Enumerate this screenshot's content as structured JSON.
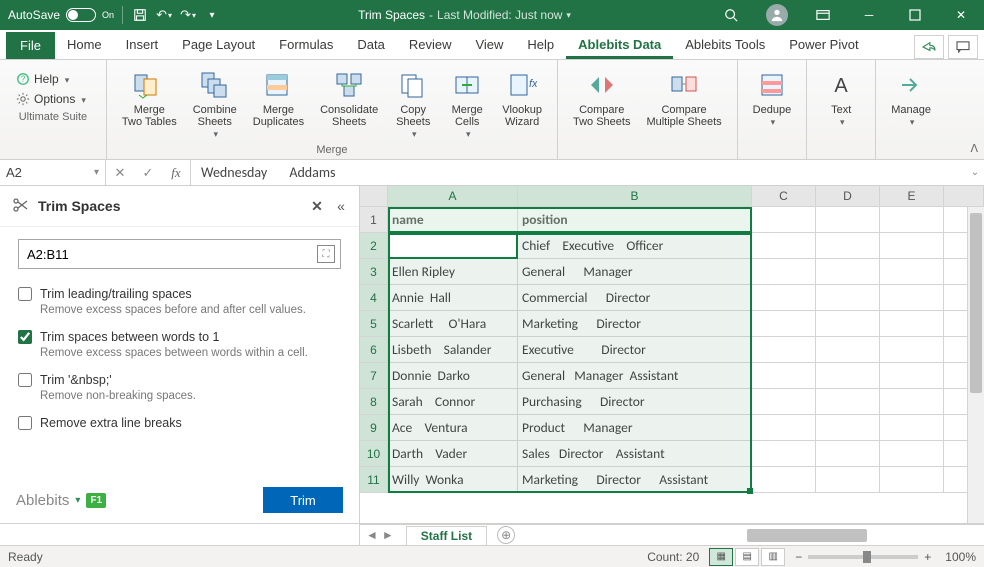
{
  "titlebar": {
    "autosave_label": "AutoSave",
    "autosave_state": "On",
    "filename": "Trim Spaces",
    "sep": "-",
    "modified": "Last Modified: Just now"
  },
  "tabs": {
    "file": "File",
    "items": [
      "Home",
      "Insert",
      "Page Layout",
      "Formulas",
      "Data",
      "Review",
      "View",
      "Help",
      "Ablebits Data",
      "Ablebits Tools",
      "Power Pivot"
    ],
    "active": "Ablebits Data"
  },
  "ribbon": {
    "help": "Help",
    "options": "Options",
    "group0": "Ultimate Suite",
    "merge": {
      "two_tables": "Merge\nTwo Tables",
      "combine_sheets": "Combine\nSheets",
      "merge_dupes": "Merge\nDuplicates",
      "consolidate": "Consolidate\nSheets",
      "copy_sheets": "Copy\nSheets",
      "merge_cells": "Merge\nCells",
      "vlookup": "Vlookup\nWizard",
      "label": "Merge"
    },
    "compare": {
      "two": "Compare\nTwo Sheets",
      "multi": "Compare\nMultiple Sheets"
    },
    "dedupe": "Dedupe",
    "text": "Text",
    "manage": "Manage"
  },
  "formula_bar": {
    "name_box": "A2",
    "value": "Wednesday       Addams"
  },
  "pane": {
    "title": "Trim Spaces",
    "range": "A2:B11",
    "opt1": {
      "label": "Trim leading/trailing spaces",
      "desc": "Remove excess spaces before and after cell values.",
      "checked": false
    },
    "opt2": {
      "label": "Trim spaces between words to 1",
      "desc": "Remove excess spaces between words within a cell.",
      "checked": true
    },
    "opt3": {
      "label": "Trim '&nbsp;'",
      "desc": "Remove non-breaking spaces.",
      "checked": false
    },
    "opt4": {
      "label": "Remove extra line breaks",
      "checked": false
    },
    "brand": "Ablebits",
    "f1": "F1",
    "button": "Trim"
  },
  "grid": {
    "columns": [
      "A",
      "B",
      "C",
      "D",
      "E"
    ],
    "headers": {
      "A": "name",
      "B": "position"
    },
    "rows": [
      {
        "n": 1,
        "A": "name",
        "B": "position"
      },
      {
        "n": 2,
        "A": "Wednesday       Addams",
        "B": "Chief    Executive    Officer"
      },
      {
        "n": 3,
        "A": "Ellen Ripley",
        "B": "General      Manager"
      },
      {
        "n": 4,
        "A": "Annie  Hall",
        "B": "Commercial      Director"
      },
      {
        "n": 5,
        "A": "Scarlett     O'Hara",
        "B": "Marketing      Director"
      },
      {
        "n": 6,
        "A": "Lisbeth    Salander",
        "B": "Executive         Director"
      },
      {
        "n": 7,
        "A": "Donnie  Darko",
        "B": "General   Manager  Assistant"
      },
      {
        "n": 8,
        "A": "Sarah    Connor",
        "B": "Purchasing      Director"
      },
      {
        "n": 9,
        "A": "Ace    Ventura",
        "B": "Product      Manager"
      },
      {
        "n": 10,
        "A": "Darth    Vader",
        "B": "Sales   Director    Assistant"
      },
      {
        "n": 11,
        "A": "Willy  Wonka",
        "B": "Marketing      Director      Assistant"
      }
    ],
    "selection": {
      "from_row": 2,
      "to_row": 11,
      "from_col": "A",
      "to_col": "B"
    },
    "active_cell": "A2"
  },
  "sheetbar": {
    "active_sheet": "Staff List"
  },
  "statusbar": {
    "ready": "Ready",
    "count_label": "Count:",
    "count": "20",
    "zoom": "100%"
  }
}
